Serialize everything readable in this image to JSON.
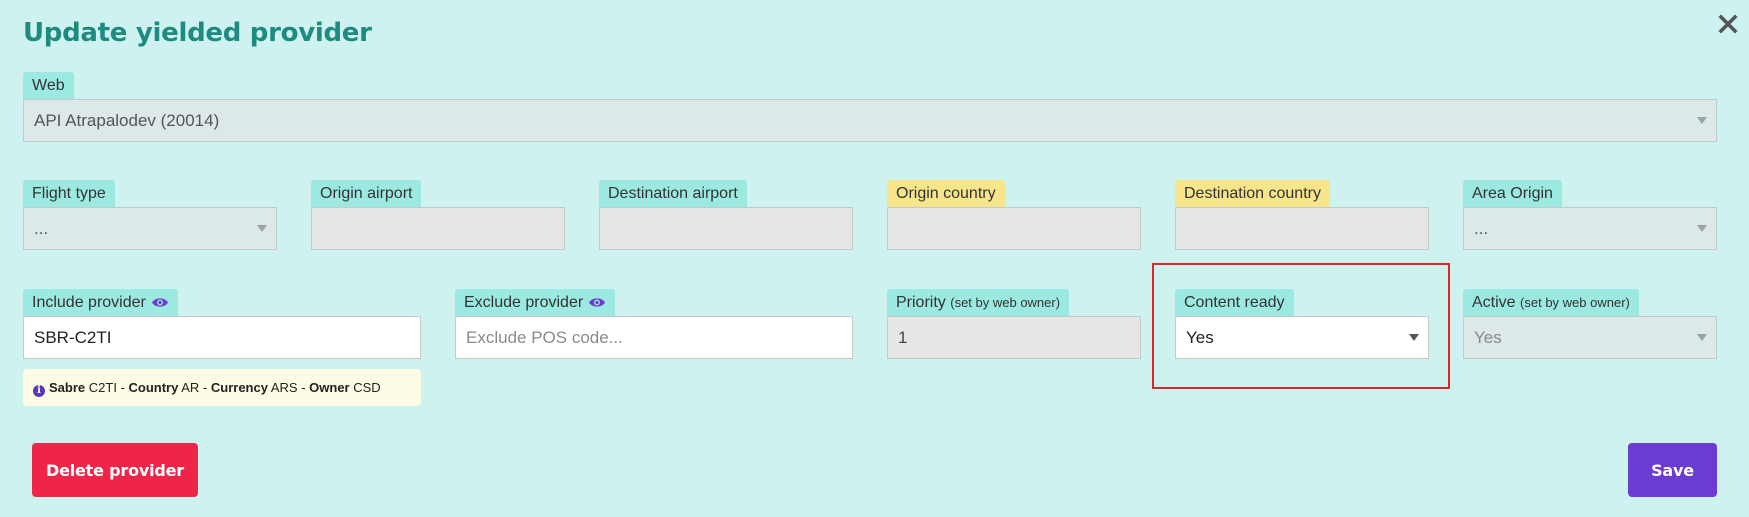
{
  "dialog": {
    "title": "Update yielded provider"
  },
  "fields": {
    "web": {
      "label": "Web",
      "value": "API Atrapalodev (20014)"
    },
    "flight_type": {
      "label": "Flight type",
      "value": "..."
    },
    "origin_airport": {
      "label": "Origin airport",
      "value": ""
    },
    "destination_airport": {
      "label": "Destination airport",
      "value": ""
    },
    "origin_country": {
      "label": "Origin country",
      "value": ""
    },
    "destination_country": {
      "label": "Destination country",
      "value": ""
    },
    "area_origin": {
      "label": "Area Origin",
      "value": "..."
    },
    "include_provider": {
      "label": "Include provider",
      "value": "SBR-C2TI"
    },
    "exclude_provider": {
      "label": "Exclude provider",
      "value": "",
      "placeholder": "Exclude POS code..."
    },
    "priority": {
      "label": "Priority",
      "label_note": "(set by web owner)",
      "value": "1"
    },
    "content_ready": {
      "label": "Content ready",
      "value": "Yes"
    },
    "active": {
      "label": "Active",
      "label_note": "(set by web owner)",
      "value": "Yes"
    }
  },
  "provider_info": {
    "provider": "Sabre",
    "code": "C2TI",
    "country_label": "Country",
    "country": "AR",
    "currency_label": "Currency",
    "currency": "ARS",
    "owner_label": "Owner",
    "owner": "CSD",
    "separator": " - "
  },
  "buttons": {
    "delete_label": "Delete provider",
    "save_label": "Save"
  },
  "colors": {
    "background": "#cdf2ef",
    "title": "#1f8a80",
    "label_teal": "#9ce9e2",
    "label_yellow": "#f6e58a",
    "delete": "#ee2449",
    "save": "#6c3bd2",
    "highlight": "#d9262b"
  },
  "icons": {
    "close": "close-icon",
    "eye": "eye-icon",
    "info": "info-icon"
  }
}
